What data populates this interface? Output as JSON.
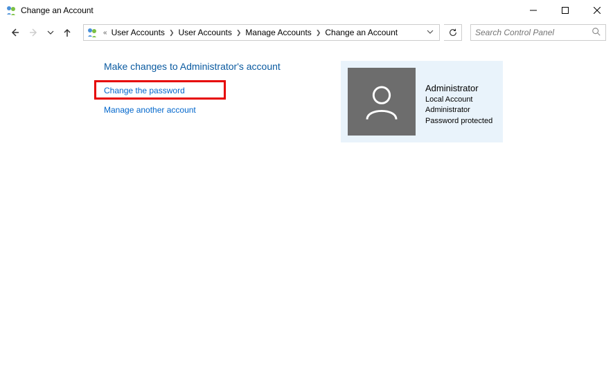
{
  "window": {
    "title": "Change an Account"
  },
  "breadcrumb": {
    "prefix": "«",
    "items": [
      "User Accounts",
      "User Accounts",
      "Manage Accounts",
      "Change an Account"
    ]
  },
  "search": {
    "placeholder": "Search Control Panel"
  },
  "page": {
    "heading": "Make changes to Administrator's account",
    "links": {
      "change_password": "Change the password",
      "manage_another": "Manage another account"
    }
  },
  "account": {
    "name": "Administrator",
    "type": "Local Account",
    "role": "Administrator",
    "password_status": "Password protected"
  }
}
